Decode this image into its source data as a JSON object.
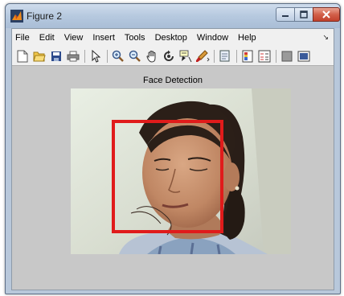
{
  "window": {
    "title": "Figure 2"
  },
  "menu": {
    "items": [
      "File",
      "Edit",
      "View",
      "Insert",
      "Tools",
      "Desktop",
      "Window",
      "Help"
    ]
  },
  "toolbar": {
    "buttons": [
      "new-figure-icon",
      "open-file-icon",
      "save-icon",
      "print-icon",
      "edit-plot-arrow-icon",
      "zoom-in-icon",
      "zoom-out-icon",
      "pan-hand-icon",
      "rotate-3d-icon",
      "data-cursor-icon",
      "brush-icon",
      "link-plot-icon",
      "colorbar-icon",
      "legend-icon",
      "hide-plot-tools-icon",
      "show-plot-tools-icon"
    ]
  },
  "figure": {
    "axes_title": "Face Detection",
    "detection_color": "#e01b1b"
  },
  "colors": {
    "titlebar": "#b6c9df",
    "figure_background": "#c8c8c8",
    "close_button": "#c2412c"
  }
}
